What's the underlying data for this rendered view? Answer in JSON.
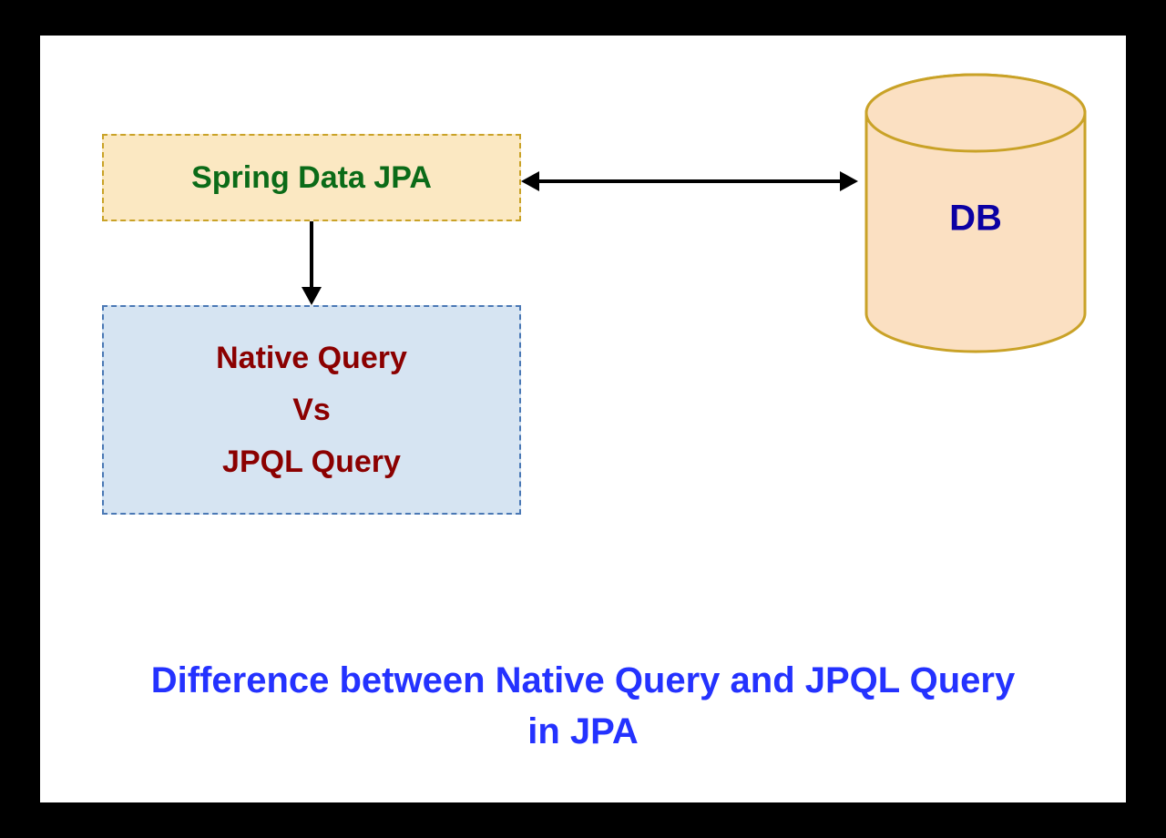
{
  "spring_box": {
    "label": "Spring Data JPA"
  },
  "query_box": {
    "line1": "Native Query",
    "line2": "Vs",
    "line3": "JPQL Query"
  },
  "db": {
    "label": "DB"
  },
  "caption": {
    "line1": "Difference between Native Query and JPQL Query",
    "line2": "in JPA"
  },
  "colors": {
    "spring_text": "#0b6b18",
    "spring_bg": "#fbe8c2",
    "spring_border": "#c9a227",
    "query_text": "#8b0000",
    "query_bg": "#d6e4f2",
    "query_border": "#4a78b5",
    "db_fill": "#fbe0c2",
    "db_stroke": "#c9a227",
    "db_text": "#0b00a3",
    "caption_text": "#2432ff"
  }
}
